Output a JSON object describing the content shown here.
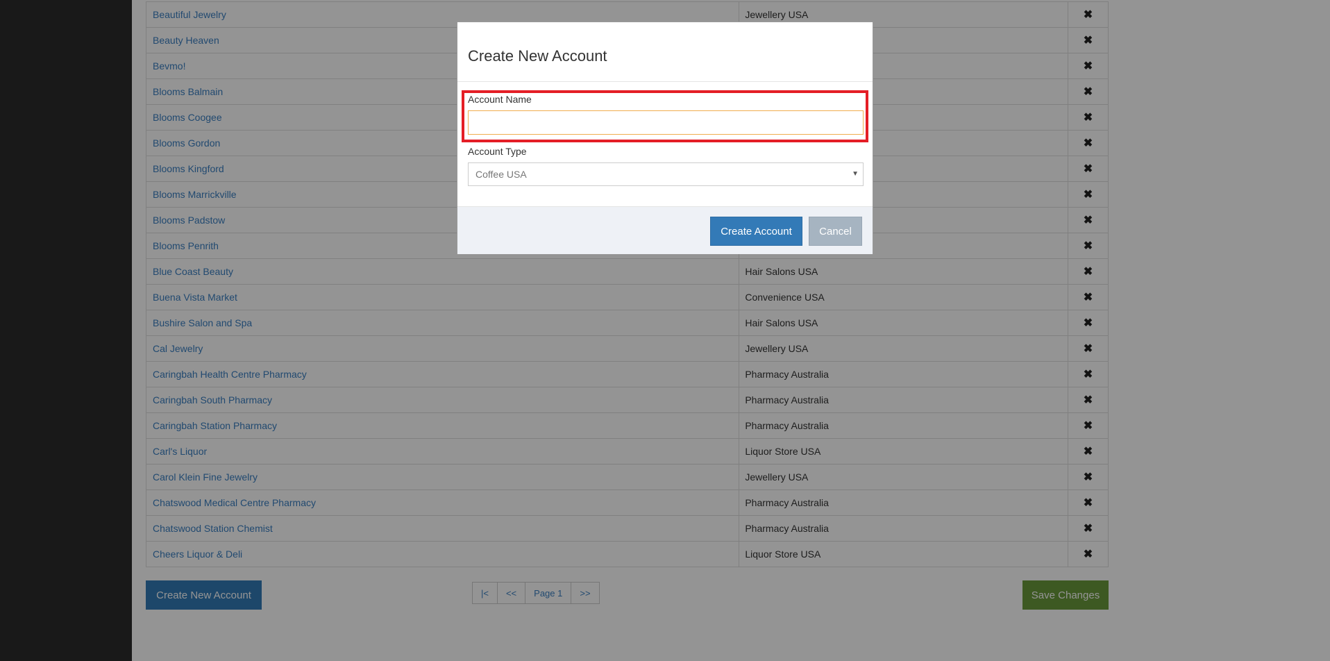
{
  "accounts": [
    {
      "name": "Beautiful Jewelry",
      "type": "Jewellery USA"
    },
    {
      "name": "Beauty Heaven",
      "type": ""
    },
    {
      "name": "Bevmo!",
      "type": ""
    },
    {
      "name": "Blooms Balmain",
      "type": ""
    },
    {
      "name": "Blooms Coogee",
      "type": ""
    },
    {
      "name": "Blooms Gordon",
      "type": ""
    },
    {
      "name": "Blooms Kingford",
      "type": ""
    },
    {
      "name": "Blooms Marrickville",
      "type": ""
    },
    {
      "name": "Blooms Padstow",
      "type": ""
    },
    {
      "name": "Blooms Penrith",
      "type": ""
    },
    {
      "name": "Blue Coast Beauty",
      "type": "Hair Salons USA"
    },
    {
      "name": "Buena Vista Market",
      "type": "Convenience USA"
    },
    {
      "name": "Bushire Salon and Spa",
      "type": "Hair Salons USA"
    },
    {
      "name": "Cal Jewelry",
      "type": "Jewellery USA"
    },
    {
      "name": "Caringbah Health Centre Pharmacy",
      "type": "Pharmacy Australia"
    },
    {
      "name": "Caringbah South Pharmacy",
      "type": "Pharmacy Australia"
    },
    {
      "name": "Caringbah Station Pharmacy",
      "type": "Pharmacy Australia"
    },
    {
      "name": "Carl's Liquor",
      "type": "Liquor Store USA"
    },
    {
      "name": "Carol Klein Fine Jewelry",
      "type": "Jewellery USA"
    },
    {
      "name": "Chatswood Medical Centre Pharmacy",
      "type": "Pharmacy Australia"
    },
    {
      "name": "Chatswood Station Chemist",
      "type": "Pharmacy Australia"
    },
    {
      "name": "Cheers Liquor & Deli",
      "type": "Liquor Store USA"
    }
  ],
  "delete_glyph": "✖",
  "footer": {
    "create_new_label": "Create New Account",
    "pagination": {
      "first": "|<",
      "prev": "<<",
      "page": "Page 1",
      "next": ">>"
    },
    "save_label": "Save Changes"
  },
  "modal": {
    "title": "Create New Account",
    "account_name_label": "Account Name",
    "account_name_value": "",
    "account_type_label": "Account Type",
    "account_type_selected": "Coffee USA",
    "chevron_glyph": "▼",
    "create_label": "Create Account",
    "cancel_label": "Cancel"
  },
  "colors": {
    "primary": "#337ab7",
    "success": "#6a9a3c",
    "highlight": "#e41e26",
    "cancel": "#a6b4c1",
    "link": "#3a7fc1"
  }
}
